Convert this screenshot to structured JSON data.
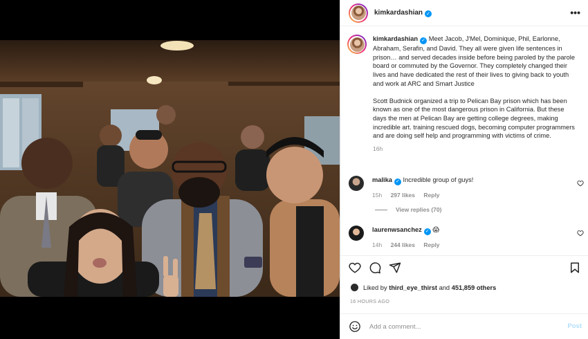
{
  "header": {
    "username": "kimkardashian",
    "verified_icon": "verified-badge-icon",
    "more_icon": "more-options-icon"
  },
  "caption": {
    "username": "kimkardashian",
    "text": "Meet Jacob, J'Mel, Dominique, Phil, Earlonne, Abraham, Serafin, and David. They all were given life sentences in prison… and served decades inside before being paroled by the parole board or commuted by the Governor. They completely changed their lives and have dedicated the rest of their lives to giving back to youth and work at ARC and Smart Justice\n\nScott Budnick organized a trip to Pelican Bay prison which has been known as one of the most dangerous prison in California. But these days the men at Pelican Bay are getting college degrees, making incredible art. training rescued dogs, becoming computer programmers and are doing self help and programming with victims of crime.",
    "time": "16h"
  },
  "comments": [
    {
      "username": "malika",
      "text": "Incredible group of guys!",
      "time": "15h",
      "likes": "297 likes",
      "reply": "Reply",
      "view_replies": "View replies (70)"
    },
    {
      "username": "laurenwsanchez",
      "text": "😱",
      "time": "14h",
      "likes": "244 likes",
      "reply": "Reply"
    }
  ],
  "actions": {
    "icons": [
      "heart-icon",
      "comment-icon",
      "share-icon",
      "bookmark-icon"
    ]
  },
  "likes": {
    "prefix": "Liked by",
    "user": "third_eye_thirst",
    "middle": "and",
    "count": "451,859 others"
  },
  "post_time": "16 HOURS AGO",
  "add_comment": {
    "placeholder": "Add a comment...",
    "post_label": "Post"
  },
  "colors": {
    "accent": "#0095f6",
    "muted": "#8e8e8e",
    "post_disabled": "#b2dffc"
  }
}
